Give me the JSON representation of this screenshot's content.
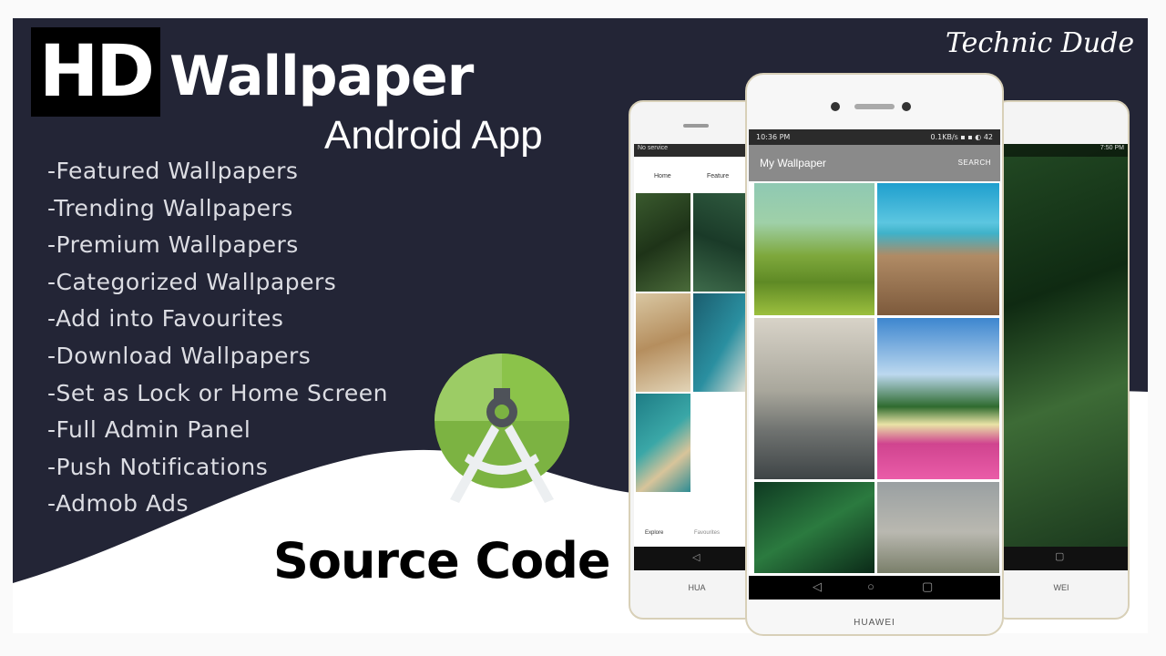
{
  "title": {
    "hd": "HD",
    "main": "Wallpaper",
    "sub": "Android App"
  },
  "brand": "Technic Dude",
  "features": [
    "-Featured Wallpapers",
    "-Trending Wallpapers",
    "-Premium Wallpapers",
    "-Categorized Wallpapers",
    "-Add into Favourites",
    "-Download Wallpapers",
    "-Set as Lock or Home Screen",
    "-Full Admin Panel",
    "-Push Notifications",
    "-Admob Ads"
  ],
  "footer": "Source Code",
  "icons": {
    "android_studio": "android-studio-icon"
  },
  "colors": {
    "navy": "#232536",
    "android_green": "#7cb342",
    "android_green_light": "#9ccc65",
    "phone_frame": "#f4f4f4"
  },
  "phone_center": {
    "status_time": "10:36 PM",
    "status_icons": "0.1KB/s ▪ ▪ ◐ 42",
    "app_title": "My Wallpaper",
    "search": "SEARCH",
    "brand": "HUAWEI"
  },
  "phone_left": {
    "status": "No service",
    "tabs": [
      "Home",
      "Feature"
    ],
    "bottom_tabs": [
      "Explore",
      "Favourites"
    ],
    "brand": "HUA"
  },
  "phone_right": {
    "status_time": "7:50 PM",
    "brand": "WEI"
  }
}
